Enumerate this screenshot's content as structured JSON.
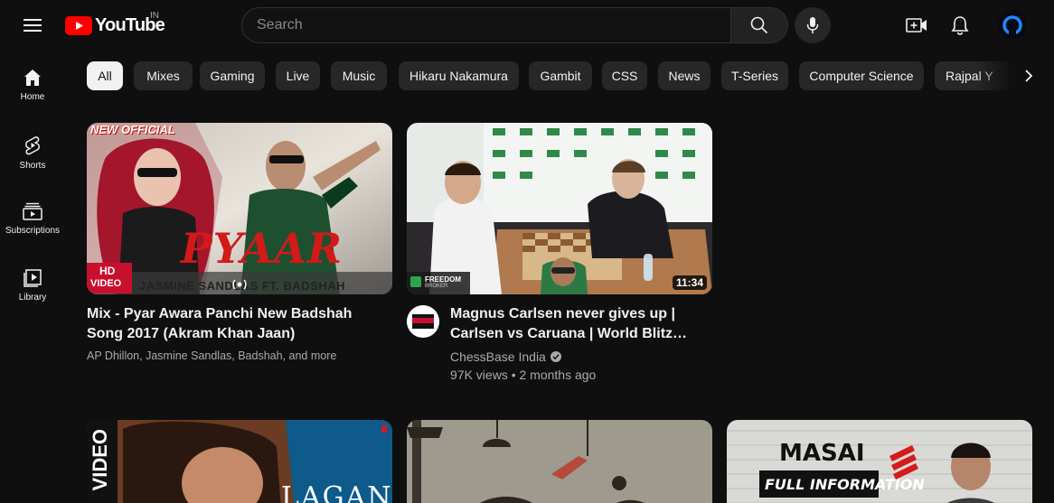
{
  "header": {
    "logo_text": "YouTube",
    "country_code": "IN",
    "search_placeholder": "Search"
  },
  "sidebar": {
    "items": [
      {
        "label": "Home",
        "icon": "home-icon"
      },
      {
        "label": "Shorts",
        "icon": "shorts-icon"
      },
      {
        "label": "Subscriptions",
        "icon": "subscriptions-icon"
      },
      {
        "label": "Library",
        "icon": "library-icon"
      }
    ]
  },
  "chips": [
    "All",
    "Mixes",
    "Gaming",
    "Live",
    "Music",
    "Hikaru Nakamura",
    "Gambit",
    "CSS",
    "News",
    "T-Series",
    "Computer Science",
    "Rajpal Y"
  ],
  "videos": [
    {
      "title_line1": "Mix - Pyar Awara Panchi New Badshah",
      "title_line2": "Song 2017 (Akram Khan Jaan)",
      "meta": "AP Dhillon, Jasmine Sandlas, Badshah, and more",
      "thumb_top_text": "NEW OFFICIAL",
      "thumb_big_text": "PYAAR",
      "thumb_hd": "HD",
      "thumb_video": "VIDEO",
      "thumb_bottom_text": "JASMINE SANDLAS FT. BADSHAH"
    },
    {
      "title_line1": "Magnus Carlsen never gives up |",
      "title_line2": "Carlsen vs Caruana | World Blitz…",
      "channel": "ChessBase India",
      "stats": "97K views • 2 months ago",
      "duration": "11:34",
      "channel_avatar_text": "ChessBase",
      "thumb_brand": "FREEDOM",
      "thumb_brand_sub": "BROKER"
    }
  ],
  "row2": {
    "card1_text": "VIDEO",
    "card1_title": "LAGAN",
    "card3_title": "MASAI",
    "card3_sub": "FULL INFORMATION"
  },
  "colors": {
    "background": "#0f0f0f",
    "chip_bg": "#272727",
    "chip_active_bg": "#f1f1f1",
    "brand_red": "#ff0000",
    "secondary_text": "#aaaaaa"
  }
}
